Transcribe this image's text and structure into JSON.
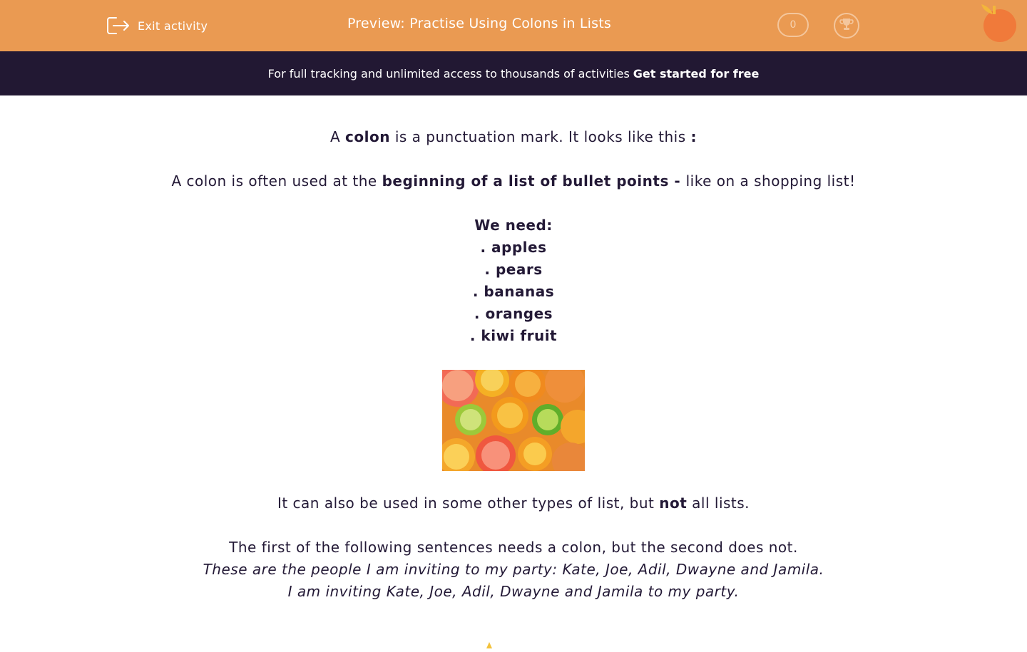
{
  "header": {
    "exit_label": "Exit activity",
    "title": "Preview: Practise Using Colons in Lists",
    "score": "0",
    "brand_color": "#ea9a52"
  },
  "promo": {
    "text": "For full tracking and unlimited access to thousands of activities",
    "link": "Get started for free",
    "background": "#221833"
  },
  "content": {
    "p1": {
      "a": "A ",
      "b": "colon",
      "c": " is a punctuation mark. It looks like this ",
      "d": ":"
    },
    "p2": {
      "a": "A colon is often used at the ",
      "b": "beginning of a list of bullet points - ",
      "c": "like on a shopping list!"
    },
    "list_heading": "We need:",
    "list_items": [
      ". apples",
      ". pears",
      ". bananas",
      ". oranges",
      ". kiwi fruit"
    ],
    "image_alt": "citrus fruit",
    "p3": {
      "a": "It can also be used in some other types of list, but ",
      "b": "not",
      "c": " all lists."
    },
    "p4": "The first of the following sentences needs a colon, but the second does not.",
    "example1": "These are the people I am inviting to my party: Kate, Joe, Adil, Dwayne and Jamila.",
    "example2": "I am inviting Kate, Joe, Adil, Dwayne and Jamila to my party."
  },
  "icons": {
    "exit": "exit-icon",
    "trophy": "trophy-icon",
    "logo": "orange-logo-icon"
  }
}
